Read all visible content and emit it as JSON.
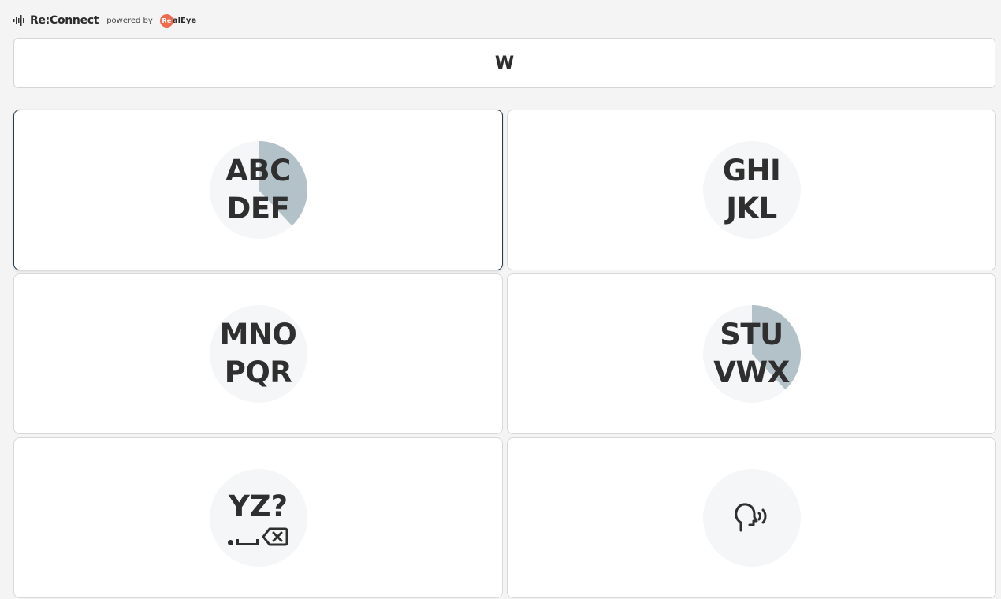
{
  "header": {
    "brand": "Re:Connect",
    "powered_by": "powered by",
    "partner_badge": "Re",
    "partner_rest": "alEye"
  },
  "output": {
    "text": "W"
  },
  "tiles": [
    {
      "line1": "ABC",
      "line2": "DEF",
      "progress": 0.38,
      "active": true
    },
    {
      "line1": "GHI",
      "line2": "JKL",
      "progress": 0,
      "active": false
    },
    {
      "line1": "MNO",
      "line2": "PQR",
      "progress": 0,
      "active": false
    },
    {
      "line1": "STU",
      "line2": "VWX",
      "progress": 0.38,
      "active": false
    },
    {
      "line1": "YZ?",
      "icons": [
        "dot-icon",
        "space-icon",
        "backspace-icon"
      ],
      "progress": 0,
      "active": false
    },
    {
      "icons": [
        "speak-icon"
      ],
      "progress": 0,
      "active": false
    }
  ],
  "colors": {
    "progress_fill": "#b3c2c9",
    "active_border": "#203a4e",
    "brand_orange": "#f06a4f"
  }
}
